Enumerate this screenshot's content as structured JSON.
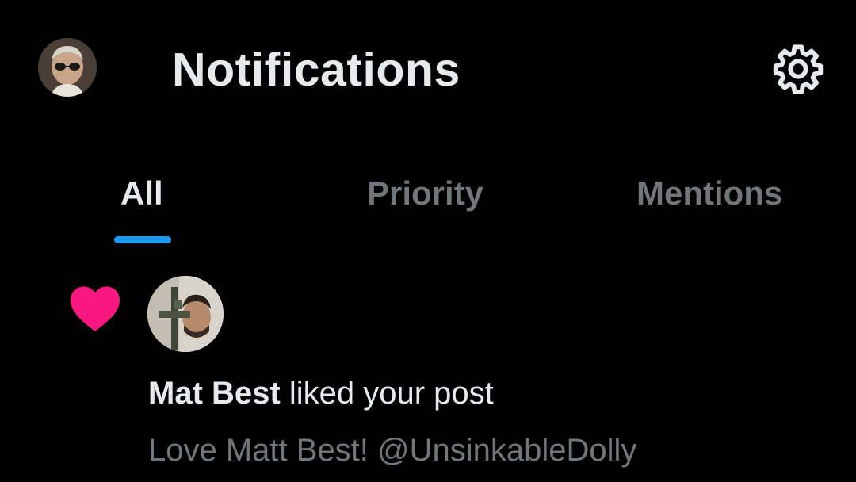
{
  "header": {
    "title": "Notifications",
    "avatar_icon": "profile-avatar-icon",
    "settings_icon": "gear-icon"
  },
  "tabs": [
    {
      "label": "All",
      "active": true
    },
    {
      "label": "Priority",
      "active": false
    },
    {
      "label": "Mentions",
      "active": false
    }
  ],
  "notifications": [
    {
      "type_icon": "heart-icon",
      "actor": "Mat Best",
      "action": " liked your post",
      "snippet": "Love Matt Best! @UnsinkableDolly"
    }
  ],
  "colors": {
    "background": "#000000",
    "text_primary": "#e7e9ea",
    "text_secondary": "#71767b",
    "accent_blue": "#1d9bf0",
    "like_pink": "#f91880",
    "divider": "#2f3336"
  }
}
